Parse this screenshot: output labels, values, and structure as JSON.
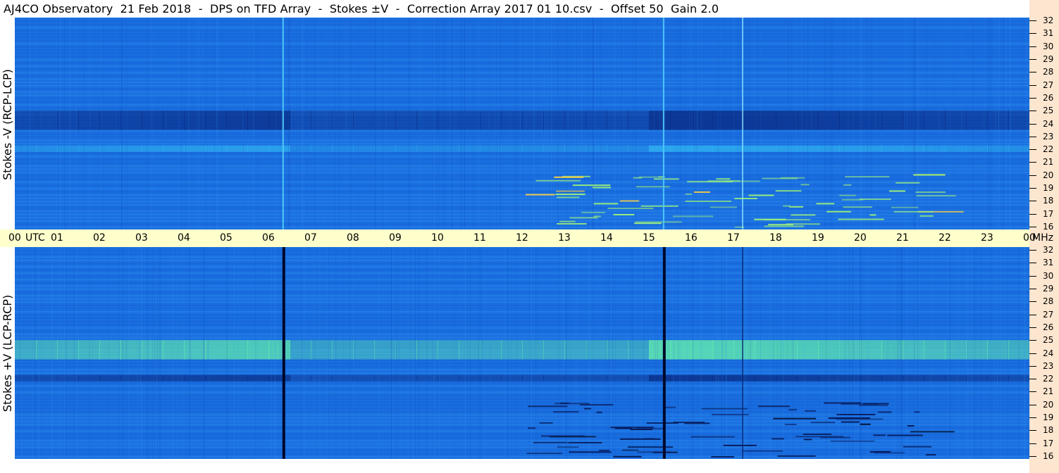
{
  "title": "AJ4CO Observatory  21 Feb 2018  -  DPS on TFD Array  -  Stokes ±V  -  Correction Array 2017 01 10.csv  -  Offset 50  Gain 2.0",
  "chart_data": [
    {
      "type": "heatmap",
      "panel": "top",
      "ylabel": "Stokes -V (RCP-LCP)",
      "x_label_units": "UTC",
      "y_units": "MHz",
      "x_ticks": [
        "00",
        "01",
        "02",
        "03",
        "04",
        "05",
        "06",
        "07",
        "08",
        "09",
        "10",
        "11",
        "12",
        "13",
        "14",
        "15",
        "16",
        "17",
        "18",
        "19",
        "20",
        "21",
        "22",
        "23",
        "00"
      ],
      "y_ticks": [
        32,
        31,
        30,
        29,
        28,
        27,
        26,
        25,
        24,
        23,
        22,
        21,
        20,
        19,
        18,
        17,
        16
      ],
      "ylim": [
        16,
        32
      ],
      "xlim_hours": [
        0,
        24
      ],
      "colors": {
        "background": "#1a6fe0",
        "dark_band": "#0a2f8a",
        "bright_band": "#2fb0f0"
      },
      "dark_bands_mhz": [
        [
          23.5,
          25.0
        ]
      ],
      "bright_bands_mhz": [
        [
          21.8,
          22.3
        ]
      ],
      "vertical_lines_utc": [
        6.33,
        15.33,
        17.2
      ],
      "events_utc": [
        [
          12.0,
          20.0
        ]
      ]
    },
    {
      "type": "heatmap",
      "panel": "bottom",
      "ylabel": "Stokes +V (LCP-RCP)",
      "x_label_units": "UTC",
      "y_units": "MHz",
      "y_ticks": [
        32,
        31,
        30,
        29,
        28,
        27,
        26,
        25,
        24,
        23,
        22,
        21,
        20,
        19,
        18,
        17,
        16
      ],
      "ylim": [
        16,
        32
      ],
      "xlim_hours": [
        0,
        24
      ],
      "colors": {
        "background": "#1a6fe0",
        "dark_band": "#0a2f8a",
        "bright_band": "#5fe6b0"
      },
      "bright_bands_mhz": [
        [
          23.5,
          25.0
        ]
      ],
      "dark_bands_mhz": [
        [
          21.8,
          22.3
        ]
      ],
      "vertical_lines_utc": [
        6.33,
        15.33,
        17.2
      ],
      "events_utc": [
        [
          12.0,
          20.0
        ]
      ]
    }
  ],
  "axis_unit_time": "UTC",
  "axis_unit_freq": "MHz"
}
